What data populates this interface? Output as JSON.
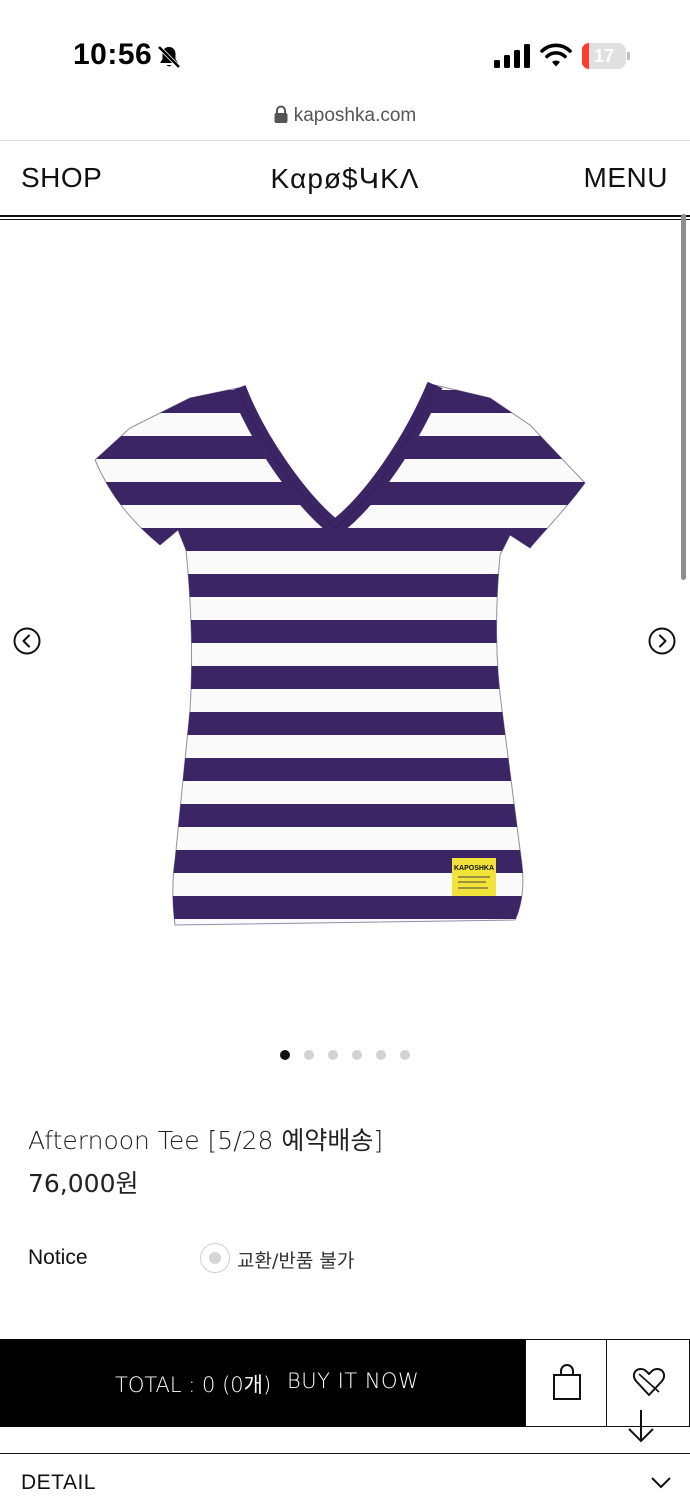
{
  "status_bar": {
    "time": "10:56",
    "battery_level": "17",
    "icons": [
      "bell-off-icon",
      "signal-icon",
      "wifi-icon",
      "battery-icon"
    ],
    "battery_color": "#ff3b30"
  },
  "browser": {
    "url": "kaposhka.com",
    "lock_icon": "lock-icon"
  },
  "header": {
    "shop_label": "SHOP",
    "logo_text": "Kαpø$ԿKΛ",
    "menu_label": "MENU"
  },
  "gallery": {
    "slide_count": 6,
    "active_index": 0,
    "prev_icon": "chevron-left-circle-icon",
    "next_icon": "chevron-right-circle-icon",
    "image": {
      "subject": "purple and white striped v-neck short sleeve tee",
      "stripe_color": "#3b2565",
      "tag_text": "KAPOSHKA",
      "tag_color": "#f2e33a"
    }
  },
  "product": {
    "title": "Afternoon Tee [5/28 예약배송]",
    "price": "76,000원"
  },
  "notice": {
    "label": "Notice",
    "option": "교환/반품 불가"
  },
  "purchase_bar": {
    "total": "TOTAL : 0 (0개)",
    "buy_now": "BUY IT NOW",
    "cart_icon": "shopping-bag-icon",
    "wish_icon": "heart-icon",
    "background": "#000000"
  },
  "detail": {
    "label": "DETAIL",
    "chevron_icon": "chevron-down-icon"
  }
}
